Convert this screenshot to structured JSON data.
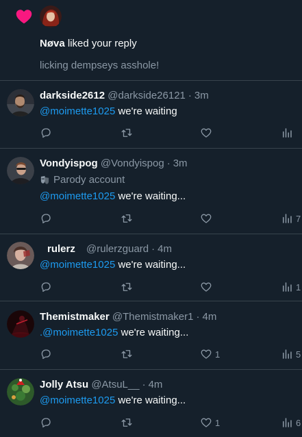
{
  "notification": {
    "liker_name": "Nøva",
    "liked_text": " liked your reply",
    "quoted_reply": "licking dempseys asshole!"
  },
  "tweets": [
    {
      "name": "darkside2612",
      "handle": "@darkside26121",
      "dot": "·",
      "time": "3m",
      "prefix": "",
      "mention": "@moimette1025",
      "text": " we're waiting",
      "parody": "",
      "likes": "",
      "views": ""
    },
    {
      "name": "Vondyispog",
      "handle": "@Vondyispog",
      "dot": "·",
      "time": "3m",
      "prefix": "",
      "mention": "@moimette1025",
      "text": " we're waiting...",
      "parody": "Parody account",
      "likes": "",
      "views": "7"
    },
    {
      "name": "rulerz",
      "handle": "@rulerzguard",
      "dot": "·",
      "time": "4m",
      "prefix": "",
      "mention": "@moimette1025",
      "text": " we're waiting...",
      "parody": "",
      "likes": "",
      "views": "1"
    },
    {
      "name": "Themistmaker",
      "handle": "@Themistmaker1",
      "dot": "·",
      "time": "4m",
      "prefix": ".",
      "mention": "@moimette1025",
      "text": " we're waiting...",
      "parody": "",
      "likes": "1",
      "views": "5"
    },
    {
      "name": "Jolly Atsu",
      "handle": "@AtsuL__",
      "dot": "·",
      "time": "4m",
      "prefix": "",
      "mention": "@moimette1025",
      "text": " we're waiting...",
      "parody": "",
      "likes": "1",
      "views": "6"
    }
  ],
  "colors": {
    "background": "#15202b",
    "like_pink": "#f91880",
    "mention_blue": "#1d9bf0",
    "muted": "#8b98a5",
    "divider": "#38444d"
  },
  "icons": [
    "heart-icon",
    "reply-icon",
    "retweet-icon",
    "like-icon",
    "views-icon",
    "parody-mask-icon"
  ]
}
